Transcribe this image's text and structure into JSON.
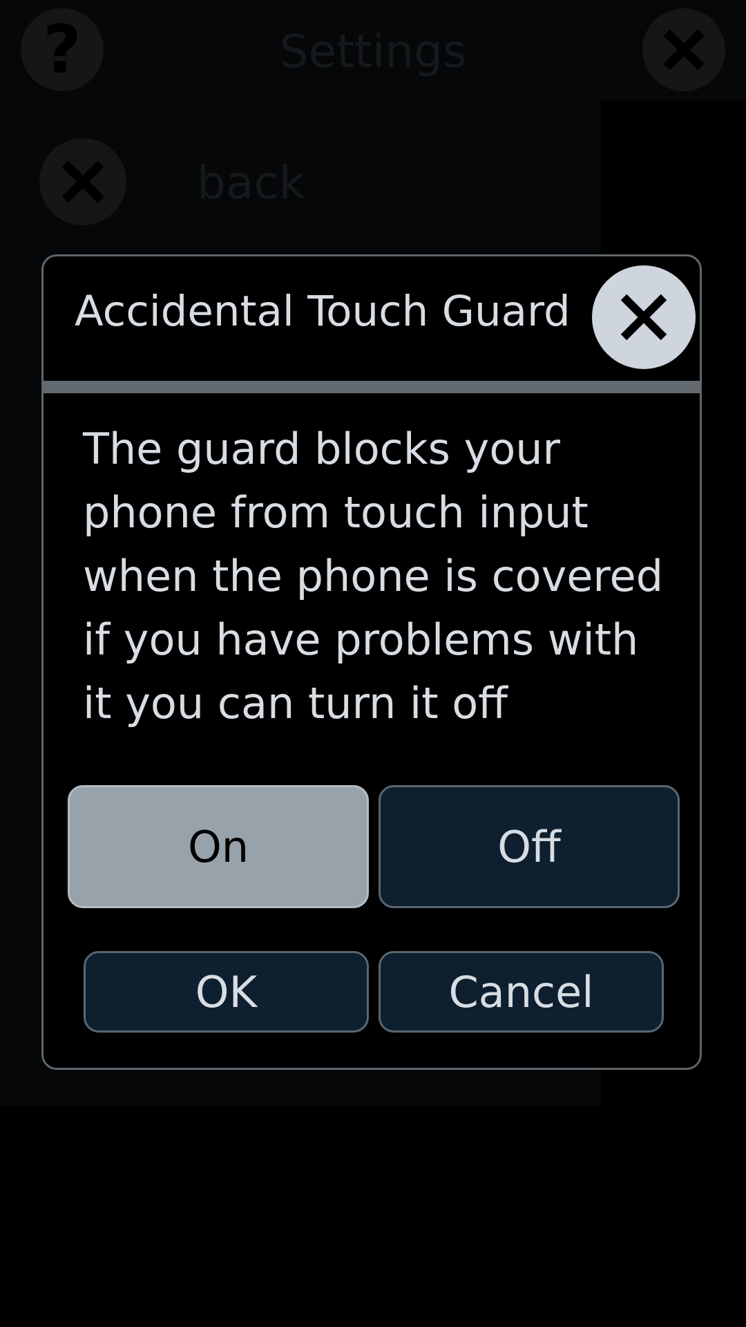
{
  "background": {
    "title": "Settings",
    "help_symbol": "?",
    "back_label": "back"
  },
  "dialog": {
    "title": "Accidental Touch Guard",
    "message": "The guard blocks your phone from touch input when the phone is covered if you have problems with it you can turn it off",
    "toggle": {
      "on_label": "On",
      "off_label": "Off",
      "selected": "On"
    },
    "ok_label": "OK",
    "cancel_label": "Cancel"
  },
  "colors": {
    "dialog_border": "#5f666b",
    "selected_button": "#97a2ab",
    "button_bg": "#0e2030",
    "text": "#d7dde2",
    "close_circle": "#cfd5dc"
  },
  "icons": {
    "help": "help-icon",
    "close": "close-icon",
    "back": "back-close-icon"
  }
}
